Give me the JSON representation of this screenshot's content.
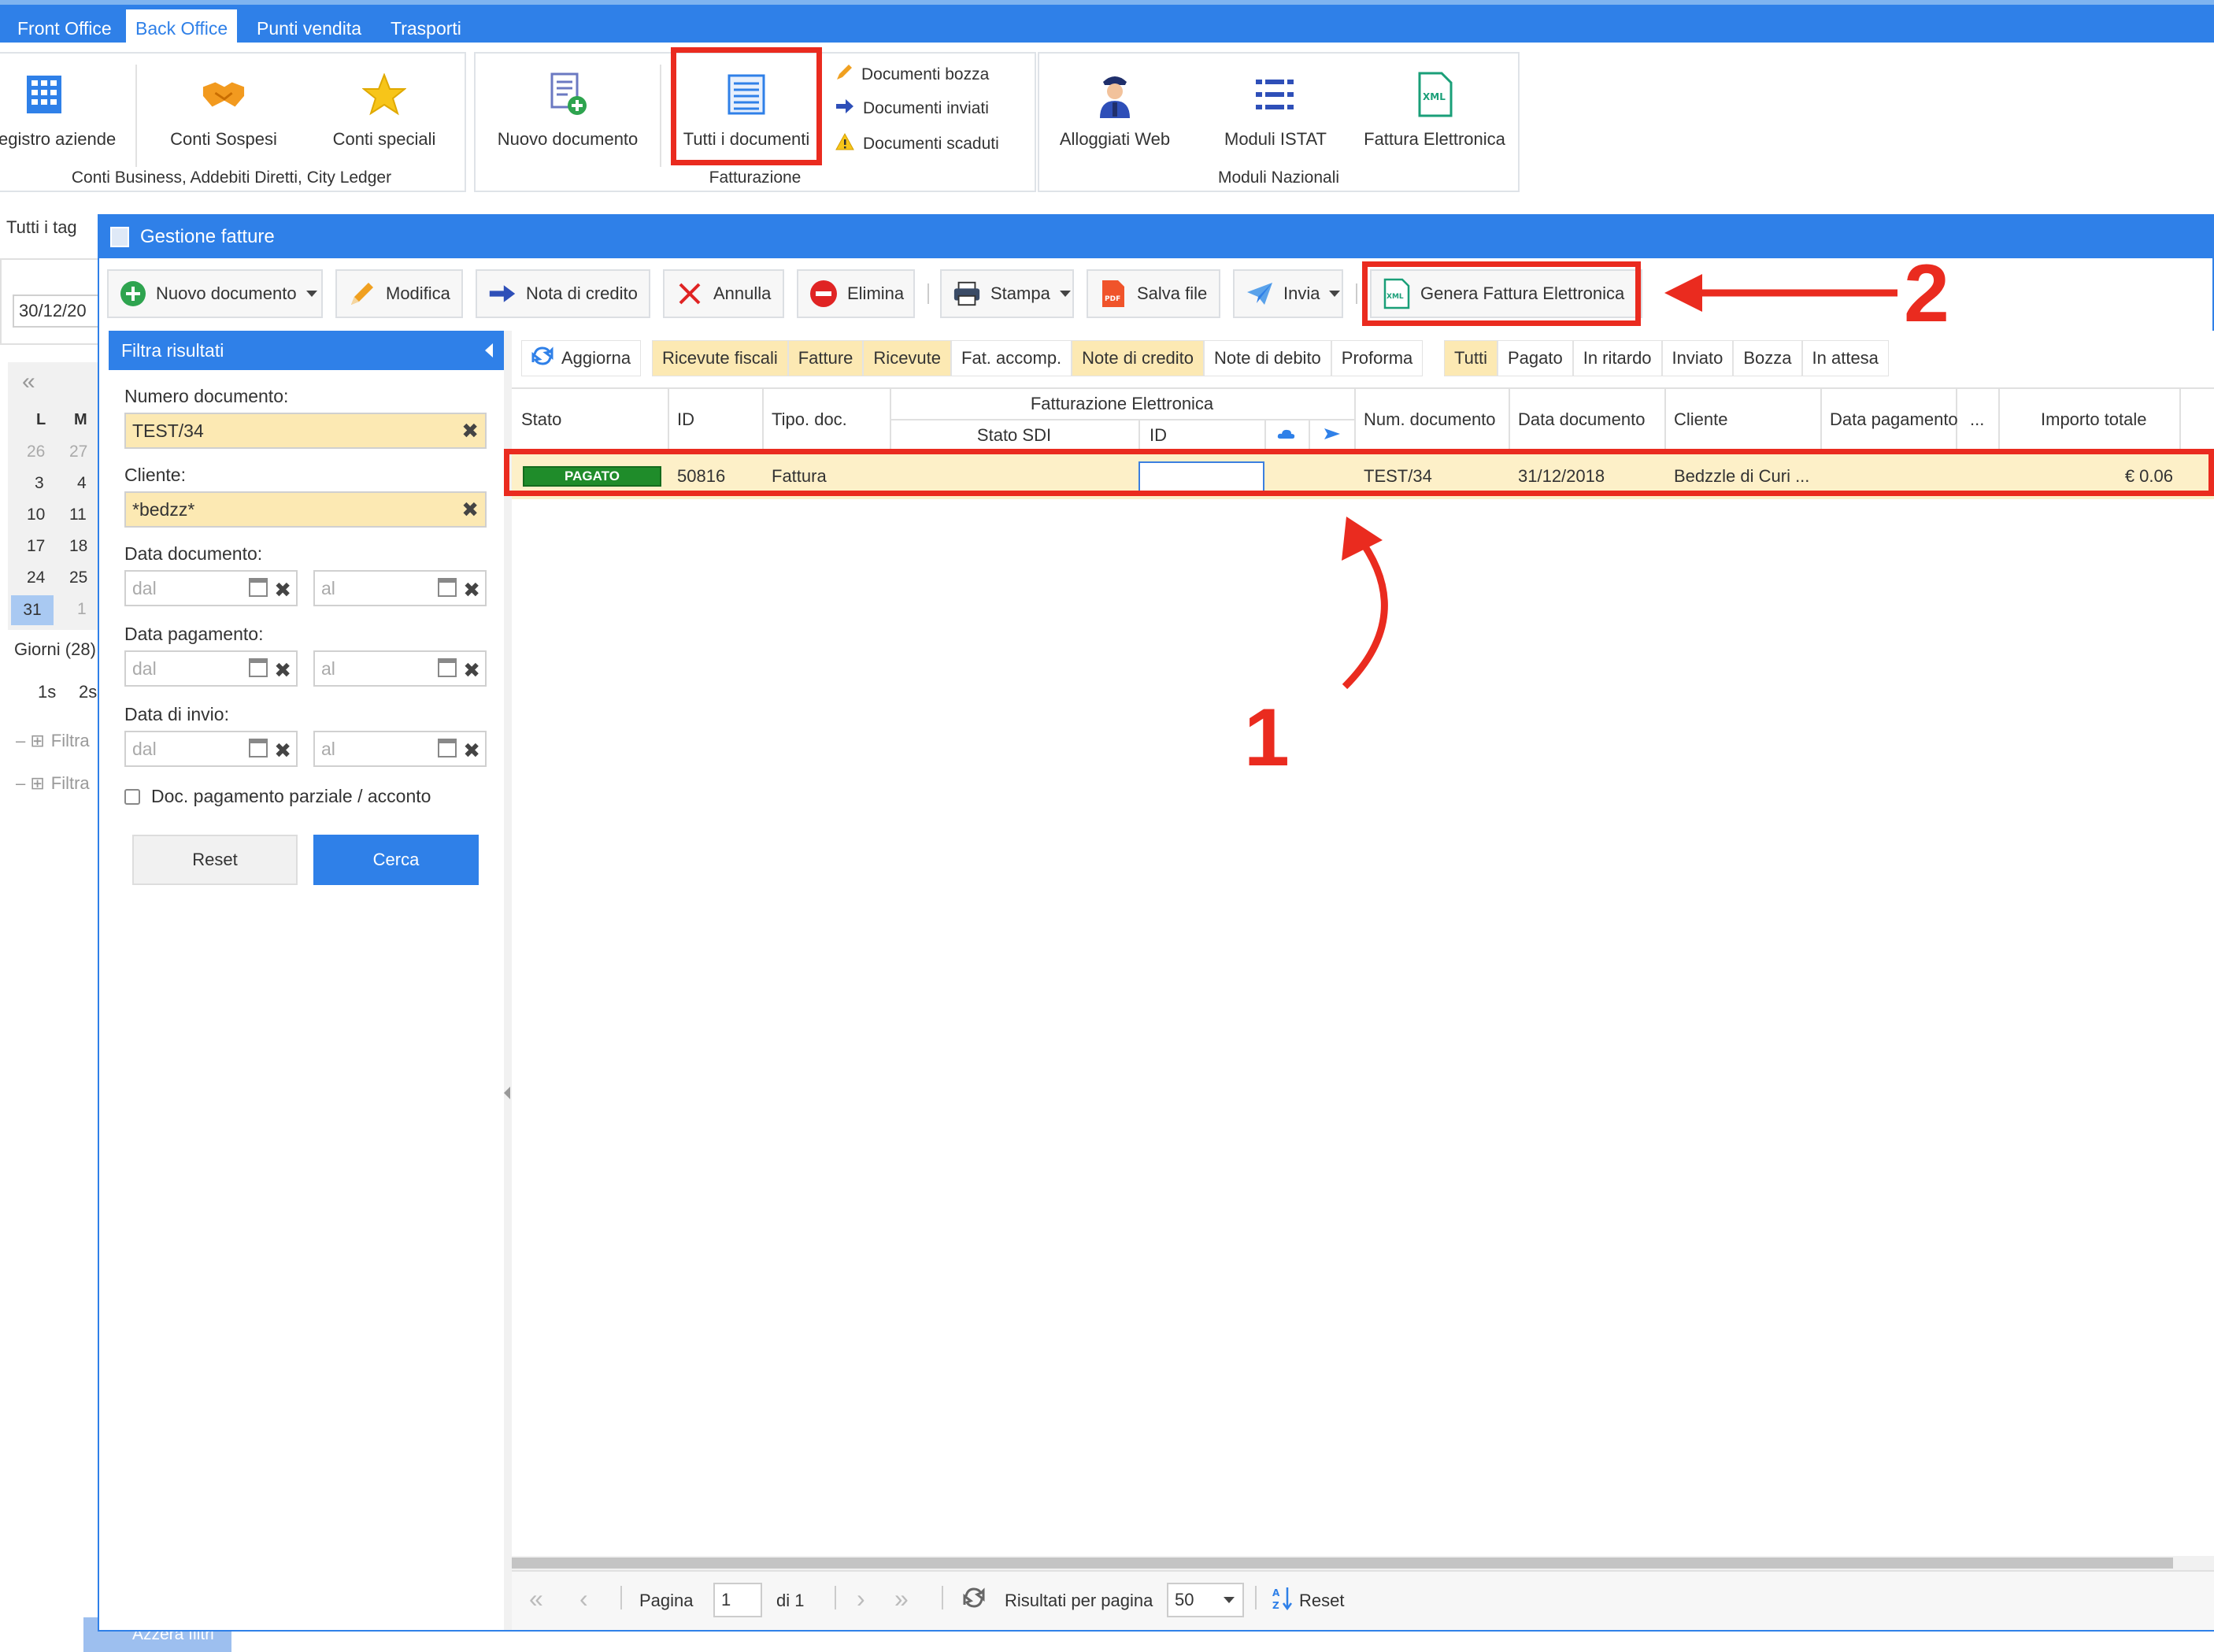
{
  "nav": {
    "tabs": [
      "Front Office",
      "Back Office",
      "Punti vendita",
      "Trasporti"
    ],
    "active": 1
  },
  "ribbon": {
    "group1": {
      "items": [
        "egistro aziende",
        "Conti Sospesi",
        "Conti speciali"
      ],
      "label": "Conti Business, Addebiti Diretti, City Ledger"
    },
    "group2": {
      "items": [
        "Nuovo documento",
        "Tutti i documenti"
      ],
      "small": [
        "Documenti bozza",
        "Documenti inviati",
        "Documenti scaduti"
      ],
      "label": "Fatturazione"
    },
    "group3": {
      "items": [
        "Alloggiati Web",
        "Moduli ISTAT",
        "Fattura Elettronica"
      ],
      "label": "Moduli Nazionali"
    }
  },
  "background": {
    "tags_label": "Tutti i tag",
    "date_value": "30/12/20",
    "cal_headers": [
      "L",
      "M"
    ],
    "cal_rows": [
      [
        "26",
        "27"
      ],
      [
        "3",
        "4"
      ],
      [
        "10",
        "11"
      ],
      [
        "17",
        "18"
      ],
      [
        "24",
        "25"
      ],
      [
        "31",
        "1"
      ]
    ],
    "days_label": "Giorni (28)",
    "shifts": [
      "1s",
      "2s"
    ],
    "filter_rows": [
      "Filtra",
      "Filtra"
    ],
    "reset_filters": "Azzera filtri"
  },
  "window": {
    "title": "Gestione fatture"
  },
  "toolbar": {
    "new_doc": "Nuovo documento",
    "edit": "Modifica",
    "credit_note": "Nota di credito",
    "cancel": "Annulla",
    "delete": "Elimina",
    "print": "Stampa",
    "save_file": "Salva file",
    "send": "Invia",
    "generate_einvoice": "Genera Fattura Elettronica"
  },
  "filter": {
    "title": "Filtra risultati",
    "doc_number_label": "Numero documento:",
    "doc_number_value": "TEST/34",
    "client_label": "Cliente:",
    "client_value": "*bedzz*",
    "doc_date_label": "Data documento:",
    "pay_date_label": "Data pagamento:",
    "send_date_label": "Data di invio:",
    "from_placeholder": "dal",
    "to_placeholder": "al",
    "partial_label": "Doc. pagamento parziale / acconto",
    "reset": "Reset",
    "search": "Cerca"
  },
  "chips": {
    "refresh": "Aggiorna",
    "types": [
      {
        "label": "Ricevute fiscali",
        "on": true
      },
      {
        "label": "Fatture",
        "on": true
      },
      {
        "label": "Ricevute",
        "on": true
      },
      {
        "label": "Fat. accomp.",
        "on": false
      },
      {
        "label": "Note di credito",
        "on": true
      },
      {
        "label": "Note di debito",
        "on": false
      },
      {
        "label": "Proforma",
        "on": false
      }
    ],
    "statuses": [
      {
        "label": "Tutti",
        "on": true
      },
      {
        "label": "Pagato",
        "on": false
      },
      {
        "label": "In ritardo",
        "on": false
      },
      {
        "label": "Inviato",
        "on": false
      },
      {
        "label": "Bozza",
        "on": false
      },
      {
        "label": "In attesa",
        "on": false
      }
    ]
  },
  "grid": {
    "headers": {
      "stato": "Stato",
      "id": "ID",
      "tipo": "Tipo. doc.",
      "fe_group": "Fatturazione Elettronica",
      "stato_sdi": "Stato SDI",
      "fe_id": "ID",
      "num": "Num. documento",
      "data_doc": "Data documento",
      "cliente": "Cliente",
      "data_pag": "Data pagamento",
      "more": "...",
      "importo": "Importo totale"
    },
    "rows": [
      {
        "stato": "PAGATO",
        "id": "50816",
        "tipo": "Fattura",
        "num": "TEST/34",
        "data_doc": "31/12/2018",
        "cliente": "Bedzzle di Curi ...",
        "importo": "€ 0.06"
      }
    ]
  },
  "pager": {
    "page_label": "Pagina",
    "page_value": "1",
    "of_label": "di 1",
    "per_page_label": "Risultati per pagina",
    "per_page_value": "50",
    "reset": "Reset"
  },
  "annotations": {
    "step1": "1",
    "step2": "2"
  },
  "colors": {
    "accent": "#2f80e8",
    "highlight_red": "#ea2b1f",
    "chip_on": "#fce9b3",
    "paid_green": "#1f8c2a"
  }
}
